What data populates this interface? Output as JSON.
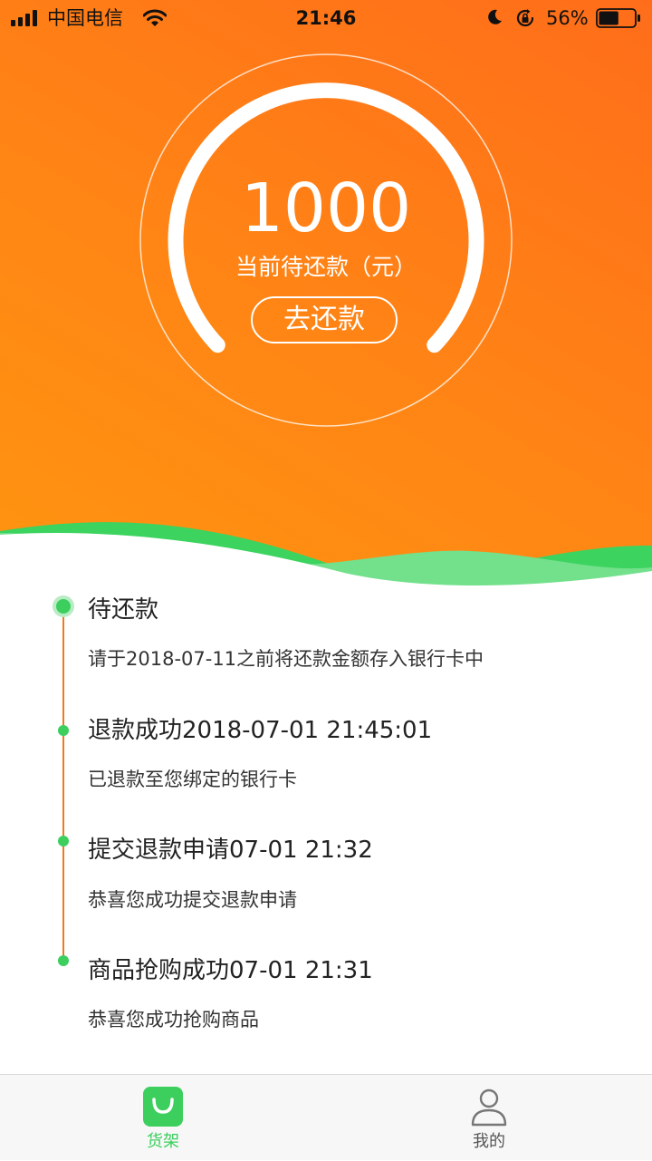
{
  "status_bar": {
    "carrier": "中国电信",
    "time": "21:46",
    "battery": "56%",
    "battery_level": 0.56
  },
  "summary": {
    "amount": "1000",
    "label": "当前待还款（元）",
    "pay_button": "去还款"
  },
  "timeline": [
    {
      "title": "待还款",
      "desc": "请于2018-07-11之前将还款金额存入银行卡中",
      "current": true
    },
    {
      "title": "退款成功2018-07-01 21:45:01",
      "desc": "已退款至您绑定的银行卡",
      "current": false
    },
    {
      "title": "提交退款申请07-01 21:32",
      "desc": "恭喜您成功提交退款申请",
      "current": false
    },
    {
      "title": "商品抢购成功07-01 21:31",
      "desc": "恭喜您成功抢购商品",
      "current": false
    }
  ],
  "tabbar": {
    "items": [
      {
        "label": "货架",
        "icon": "shopping-bag-icon",
        "active": true
      },
      {
        "label": "我的",
        "icon": "person-icon",
        "active": false
      }
    ]
  },
  "colors": {
    "accent_orange": "#ff8515",
    "accent_green": "#3ccf5e",
    "timeline_line": "#f07a1c",
    "tab_inactive": "#555555"
  }
}
